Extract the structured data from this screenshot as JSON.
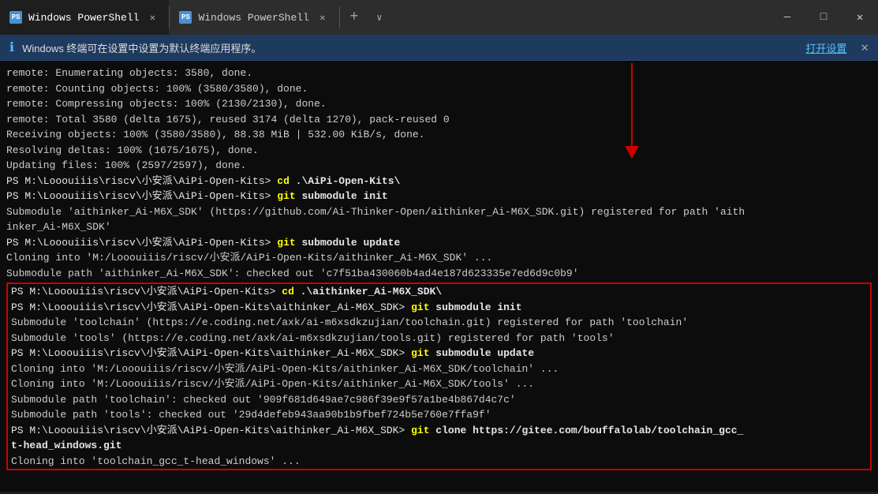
{
  "titleBar": {
    "tabs": [
      {
        "id": "tab1",
        "label": "Windows PowerShell",
        "active": true
      },
      {
        "id": "tab2",
        "label": "Windows PowerShell",
        "active": false
      }
    ],
    "newTabLabel": "+",
    "dropdownLabel": "∨",
    "minimizeLabel": "—",
    "maximizeLabel": "□",
    "closeLabel": "✕"
  },
  "infoBar": {
    "iconLabel": "ℹ",
    "text": "Windows 终端可在设置中设置为默认终端应用程序。",
    "linkText": "打开设置",
    "closeLabel": "✕"
  },
  "terminal": {
    "lines": [
      {
        "type": "normal",
        "text": "remote: Enumerating objects: 3580, done."
      },
      {
        "type": "normal",
        "text": "remote: Counting objects: 100% (3580/3580), done."
      },
      {
        "type": "normal",
        "text": "remote: Compressing objects: 100% (2130/2130), done."
      },
      {
        "type": "normal",
        "text": "remote: Total 3580 (delta 1675), reused 3174 (delta 1270), pack-reused 0"
      },
      {
        "type": "normal",
        "text": "Receiving objects: 100% (3580/3580), 88.38 MiB | 532.00 KiB/s, done."
      },
      {
        "type": "normal",
        "text": "Resolving deltas: 100% (1675/1675), done."
      },
      {
        "type": "normal",
        "text": "Updating files: 100% (2597/2597), done."
      },
      {
        "type": "prompt",
        "prefix": "PS M:\\Looouiiis\\riscv\\小安派\\AiPi-Open-Kits> ",
        "cmd": "cd .\\AiPi-Open-Kits\\"
      },
      {
        "type": "prompt",
        "prefix": "PS M:\\Looouiiis\\riscv\\小安派\\AiPi-Open-Kits> ",
        "cmd": "git submodule init"
      },
      {
        "type": "normal",
        "text": "Submodule 'aithinker_Ai-M6X_SDK' (https://github.com/Ai-Thinker-Open/aithinker_Ai-M6X_SDK.git) registered for path 'aith\ninker_Ai-M6X_SDK'"
      },
      {
        "type": "prompt",
        "prefix": "PS M:\\Looouiiis\\riscv\\小安派\\AiPi-Open-Kits> ",
        "cmd": "git submodule update"
      },
      {
        "type": "normal",
        "text": "Cloning into 'M:/Looouiiis/riscv/小安派/AiPi-Open-Kits/aithinker_Ai-M6X_SDK' ..."
      },
      {
        "type": "normal",
        "text": "Submodule path 'aithinker_Ai-M6X_SDK': checked out 'c7f51ba430060b4ad4e187d623335e7ed6d9c0b9'"
      },
      {
        "type": "highlighted_start"
      },
      {
        "type": "prompt",
        "prefix": "PS M:\\Looouiiis\\riscv\\小安派\\AiPi-Open-Kits> ",
        "cmd": "cd .\\aithinker_Ai-M6X_SDK\\"
      },
      {
        "type": "prompt",
        "prefix": "PS M:\\Looouiiis\\riscv\\小安派\\AiPi-Open-Kits\\aithinker_Ai-M6X_SDK> ",
        "cmd": "git submodule init"
      },
      {
        "type": "normal",
        "text": "Submodule 'toolchain' (https://e.coding.net/axk/ai-m6xsdkzujian/toolchain.git) registered for path 'toolchain'"
      },
      {
        "type": "normal",
        "text": "Submodule 'tools' (https://e.coding.net/axk/ai-m6xsdkzujian/tools.git) registered for path 'tools'"
      },
      {
        "type": "prompt",
        "prefix": "PS M:\\Looouiiis\\riscv\\小安派\\AiPi-Open-Kits\\aithinker_Ai-M6X_SDK> ",
        "cmd": "git submodule update"
      },
      {
        "type": "normal",
        "text": "Cloning into 'M:/Looouiiis/riscv/小安派/AiPi-Open-Kits/aithinker_Ai-M6X_SDK/toolchain' ..."
      },
      {
        "type": "normal",
        "text": "Cloning into 'M:/Looouiiis/riscv/小安派/AiPi-Open-Kits/aithinker_Ai-M6X_SDK/tools' ..."
      },
      {
        "type": "normal",
        "text": "Submodule path 'toolchain': checked out '909f681d649ae7c986f39e9f57a1be4b867d4c7c'"
      },
      {
        "type": "normal",
        "text": "Submodule path 'tools': checked out '29d4defeb943aa90b1b9fbef724b5e760e7ffa9f'"
      },
      {
        "type": "prompt",
        "prefix": "PS M:\\Looouiiis\\riscv\\小安派\\AiPi-Open-Kits\\aithinker_Ai-M6X_SDK> ",
        "cmd": "git clone https://gitee.com/bouffalolab/toolchain_gcc_\nt-head_windows.git"
      },
      {
        "type": "normal",
        "text": "Cloning into 'toolchain_gcc_t-head_windows' ..."
      },
      {
        "type": "highlighted_end"
      }
    ]
  }
}
